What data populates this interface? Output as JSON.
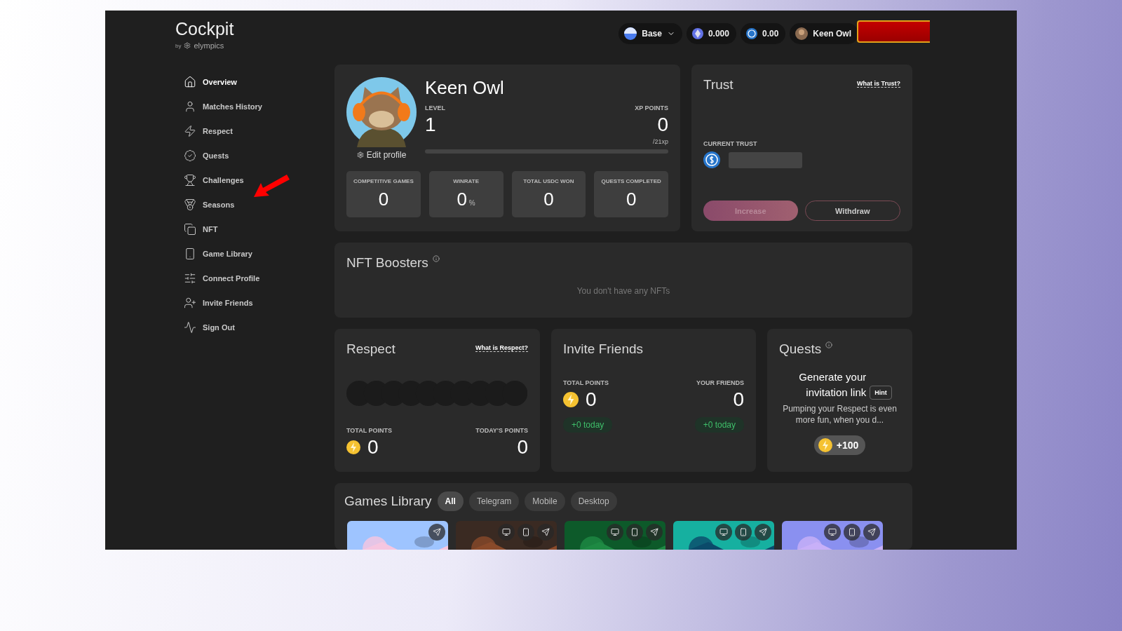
{
  "brand": {
    "title": "Cockpit",
    "byline": "by",
    "company": "elympics"
  },
  "header": {
    "network": "Base",
    "balances": [
      {
        "kind": "eth",
        "amount": "0.000"
      },
      {
        "kind": "usdc",
        "amount": "0.00"
      }
    ],
    "user": "Keen Owl",
    "redacted": true
  },
  "nav": [
    {
      "label": "Overview",
      "selected": true
    },
    {
      "label": "Matches History",
      "selected": false
    },
    {
      "label": "Respect",
      "selected": false
    },
    {
      "label": "Quests",
      "selected": false
    },
    {
      "label": "Challenges",
      "selected": false
    },
    {
      "label": "Seasons",
      "selected": false
    },
    {
      "label": "NFT",
      "selected": false
    },
    {
      "label": "Game Library",
      "selected": false
    },
    {
      "label": "Connect Profile",
      "selected": false
    },
    {
      "label": "Invite Friends",
      "selected": false
    },
    {
      "label": "Sign Out",
      "selected": false
    }
  ],
  "annotation": {
    "kind": "arrow"
  },
  "profile": {
    "name": "Keen Owl",
    "level_label": "LEVEL",
    "level_value": "1",
    "xp_label": "XP POINTS",
    "xp": "0",
    "xp_goal": "/21xp",
    "edit": "Edit profile",
    "stats": [
      {
        "label": "COMPETITIVE GAMES",
        "value": "0"
      },
      {
        "label": "WINRATE",
        "value": "0",
        "unit": "%"
      },
      {
        "label": "TOTAL USDC WON",
        "value": "0"
      },
      {
        "label": "QUESTS COMPLETED",
        "value": "0"
      }
    ]
  },
  "trust": {
    "title": "Trust",
    "link": "What is Trust?",
    "current_label": "CURRENT TRUST",
    "buttons": [
      {
        "label": "Increase",
        "kind": "primary",
        "disabled": true
      },
      {
        "label": "Withdraw",
        "kind": "outline",
        "disabled": false
      }
    ]
  },
  "nft": {
    "title": "NFT Boosters",
    "empty": "You don't have any NFTs"
  },
  "respect": {
    "title": "Respect",
    "link": "What is Respect?",
    "total_label": "TOTAL POINTS",
    "total": "0",
    "today_label": "TODAY'S POINTS",
    "today": "0"
  },
  "invite": {
    "title": "Invite Friends",
    "total_label": "TOTAL POINTS",
    "total": "0",
    "total_today": "+0 today",
    "friends_label": "YOUR FRIENDS",
    "friends": "0",
    "friends_today": "+0 today"
  },
  "quests": {
    "title": "Quests",
    "quest_title": "Generate your invitation link",
    "hint": "Hint",
    "description": "Pumping your Respect is even more fun, when you d...",
    "reward": "+100"
  },
  "games": {
    "title": "Games Library",
    "filters": [
      {
        "label": "All",
        "selected": true
      },
      {
        "label": "Telegram",
        "selected": false
      },
      {
        "label": "Mobile",
        "selected": false
      },
      {
        "label": "Desktop",
        "selected": false
      }
    ]
  }
}
